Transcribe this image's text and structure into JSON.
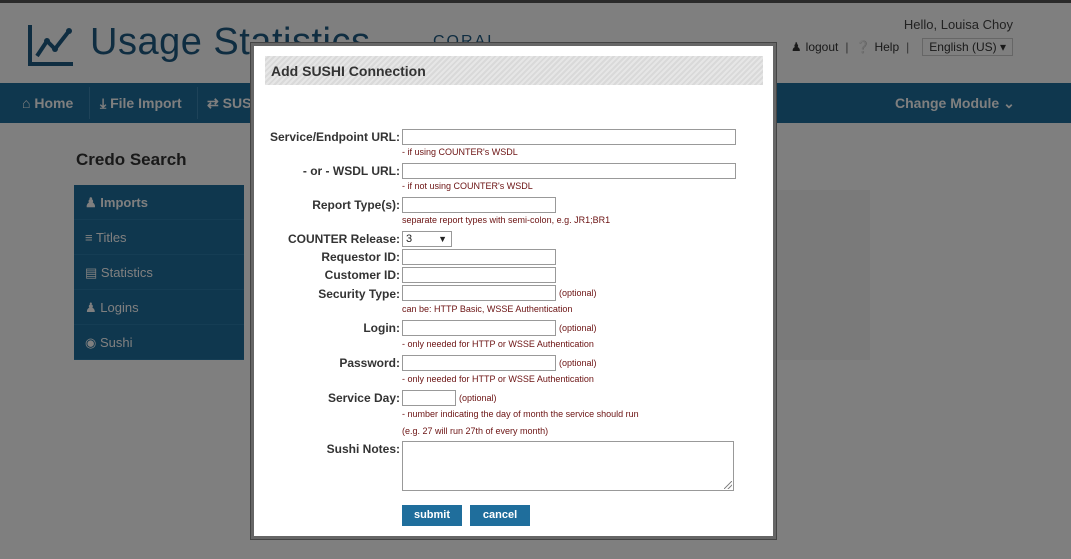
{
  "header": {
    "app_title": "Usage Statistics",
    "module_name": "CORAL",
    "greeting": "Hello, Louisa Choy",
    "logout_label": "logout",
    "help_label": "Help",
    "language": "English (US)"
  },
  "nav": {
    "home": "Home",
    "file_import": "File Import",
    "sushi": "SUSHI",
    "change_module": "Change Module"
  },
  "page": {
    "heading": "Credo Search",
    "sidebar": [
      {
        "label": "Imports",
        "icon": "users-icon"
      },
      {
        "label": "Titles",
        "icon": "list-icon"
      },
      {
        "label": "Statistics",
        "icon": "bar-chart-icon"
      },
      {
        "label": "Logins",
        "icon": "user-icon"
      },
      {
        "label": "Sushi",
        "icon": "circle-icon"
      }
    ]
  },
  "modal": {
    "title": "Add SUSHI Connection",
    "fields": {
      "service_url": {
        "label": "Service/Endpoint URL:",
        "hint": "- if using COUNTER's WSDL",
        "value": ""
      },
      "wsdl_url": {
        "label": "- or - WSDL URL:",
        "hint": "- if not using COUNTER's WSDL",
        "value": ""
      },
      "report_types": {
        "label": "Report Type(s):",
        "hint": "separate report types with semi-colon, e.g. JR1;BR1",
        "value": ""
      },
      "counter_release": {
        "label": "COUNTER Release:",
        "value": "3"
      },
      "requestor_id": {
        "label": "Requestor ID:",
        "value": ""
      },
      "customer_id": {
        "label": "Customer ID:",
        "value": ""
      },
      "security_type": {
        "label": "Security Type:",
        "optional": "(optional)",
        "hint": "can be: HTTP Basic, WSSE Authentication",
        "value": ""
      },
      "login": {
        "label": "Login:",
        "optional": "(optional)",
        "hint": "- only needed for HTTP or WSSE Authentication",
        "value": ""
      },
      "password": {
        "label": "Password:",
        "optional": "(optional)",
        "hint": "- only needed for HTTP or WSSE Authentication",
        "value": ""
      },
      "service_day": {
        "label": "Service Day:",
        "optional": "(optional)",
        "hint1": "- number indicating the day of month the service should run",
        "hint2": "(e.g. 27 will run 27th of every month)",
        "value": ""
      },
      "sushi_notes": {
        "label": "Sushi Notes:",
        "value": ""
      }
    },
    "submit_label": "submit",
    "cancel_label": "cancel"
  },
  "colors": {
    "primary": "#1f6e9c",
    "hint_text": "#6b1212",
    "overlay": "rgba(0,0,0,0.5)"
  }
}
